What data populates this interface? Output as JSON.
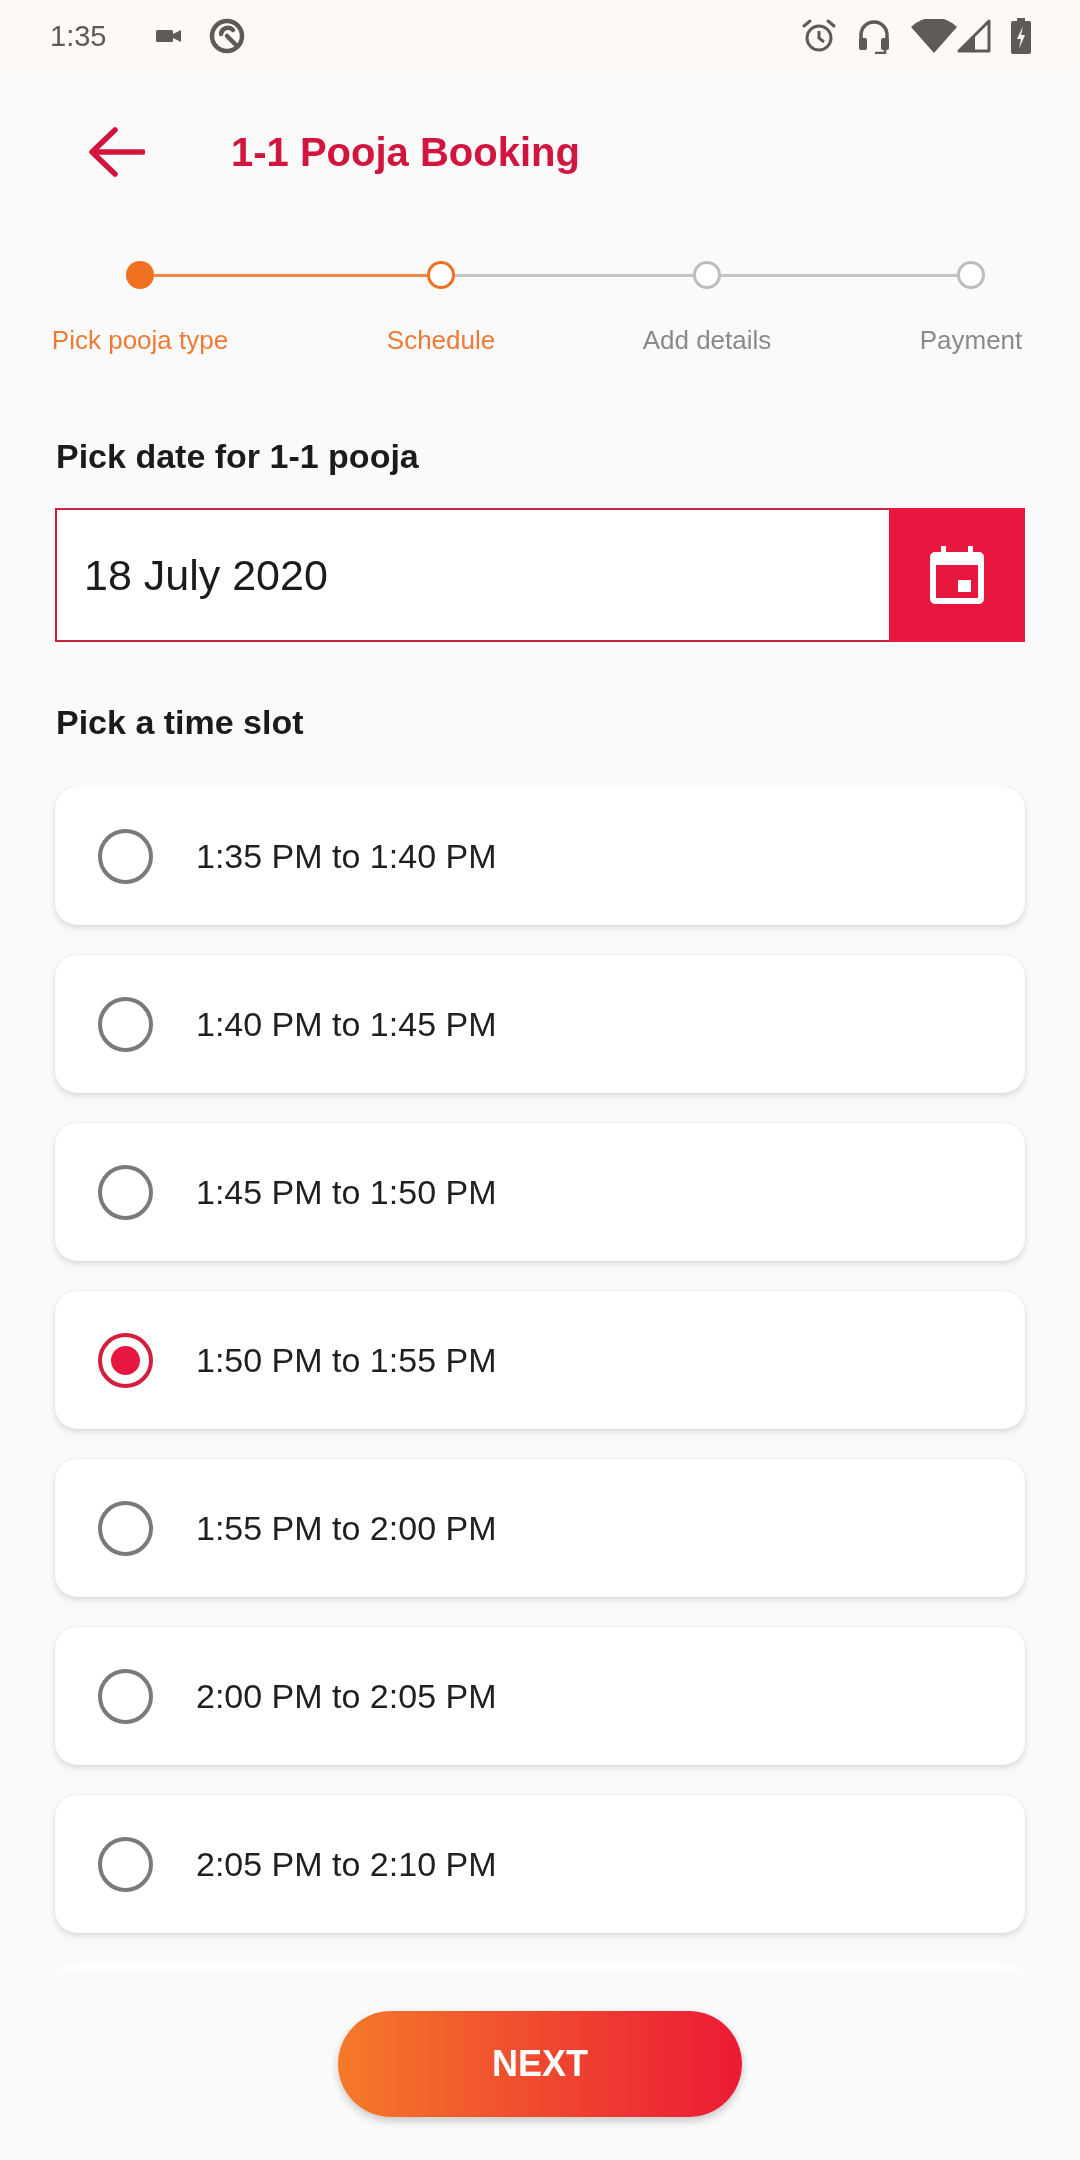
{
  "status_bar": {
    "time": "1:35"
  },
  "header": {
    "title": "1-1 Pooja Booking"
  },
  "stepper": {
    "steps": [
      {
        "label": "Pick pooja type",
        "completed": true,
        "selected": false
      },
      {
        "label": "Schedule",
        "completed": false,
        "selected": true
      },
      {
        "label": "Add details",
        "completed": false,
        "selected": false
      },
      {
        "label": "Payment",
        "completed": false,
        "selected": false
      }
    ]
  },
  "date_section": {
    "label": "Pick date for 1-1 pooja",
    "value": "18 July 2020"
  },
  "slot_section": {
    "label": "Pick a time slot",
    "slots": [
      {
        "label": "1:35 PM to 1:40 PM",
        "selected": false
      },
      {
        "label": "1:40 PM to 1:45 PM",
        "selected": false
      },
      {
        "label": "1:45 PM to 1:50 PM",
        "selected": false
      },
      {
        "label": "1:50 PM to 1:55 PM",
        "selected": true
      },
      {
        "label": "1:55 PM to 2:00 PM",
        "selected": false
      },
      {
        "label": "2:00 PM to 2:05 PM",
        "selected": false
      },
      {
        "label": "2:05 PM to 2:10 PM",
        "selected": false
      }
    ]
  },
  "next_button": {
    "label": "NEXT"
  }
}
